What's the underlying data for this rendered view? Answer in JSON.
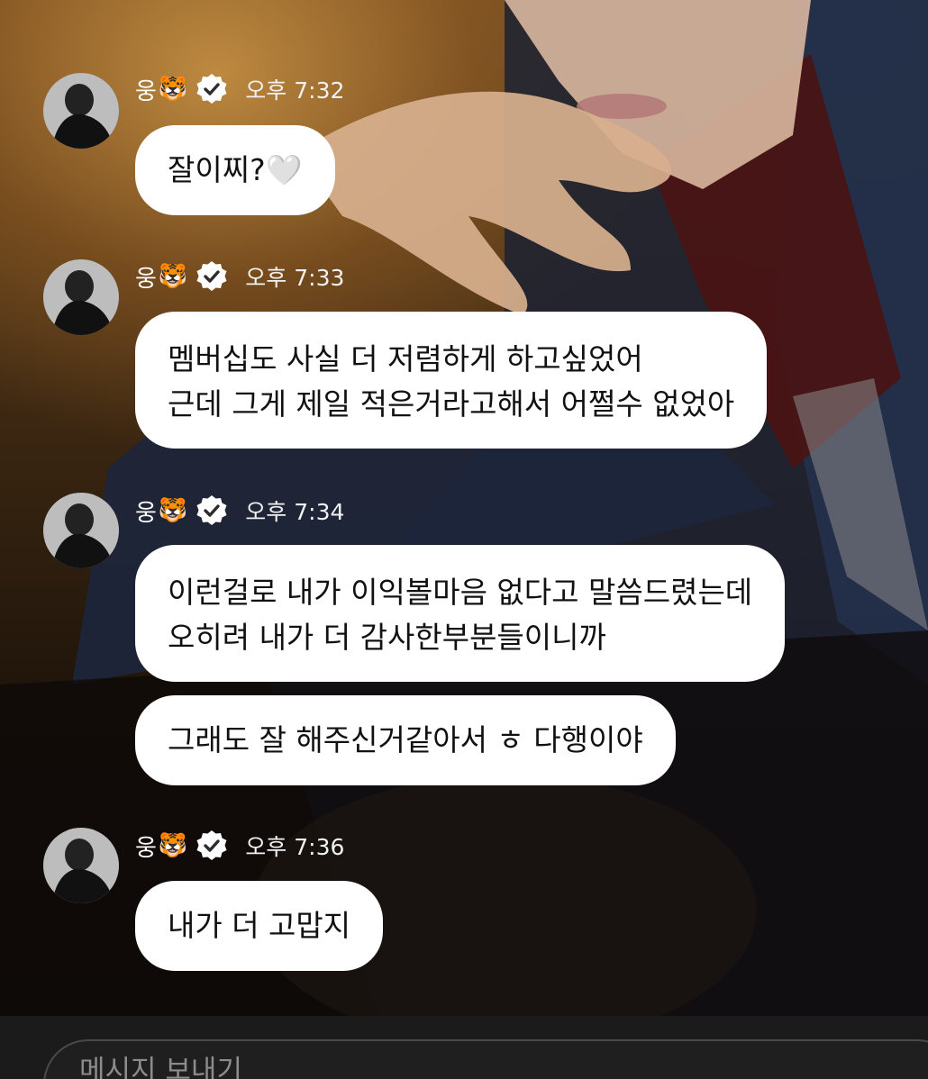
{
  "messages": [
    {
      "sender": "웅",
      "emoji": "🐯",
      "time": "오후 7:32",
      "bubbles": [
        {
          "lines": [
            "잘이찌?🤍"
          ]
        }
      ]
    },
    {
      "sender": "웅",
      "emoji": "🐯",
      "time": "오후 7:33",
      "bubbles": [
        {
          "lines": [
            "멤버십도 사실 더 저렴하게 하고싶었어",
            "근데 그게 제일 적은거라고해서 어쩔수 없었아"
          ]
        }
      ]
    },
    {
      "sender": "웅",
      "emoji": "🐯",
      "time": "오후 7:34",
      "bubbles": [
        {
          "lines": [
            "이런걸로 내가 이익볼마음 없다고 말씀드렸는데",
            "오히려 내가 더 감사한부분들이니까"
          ]
        },
        {
          "lines": [
            "그래도 잘 해주신거같아서 ㅎ 다행이야"
          ]
        }
      ]
    },
    {
      "sender": "웅",
      "emoji": "🐯",
      "time": "오후 7:36",
      "bubbles": [
        {
          "lines": [
            "내가 더 고맙지"
          ]
        }
      ]
    }
  ],
  "input": {
    "placeholder": "메시지 보내기"
  },
  "colors": {
    "bubble": "#ffffff",
    "bubble_text": "#111111",
    "meta_text": "#ffffff",
    "bottom_bar": "#1b1b1b"
  }
}
